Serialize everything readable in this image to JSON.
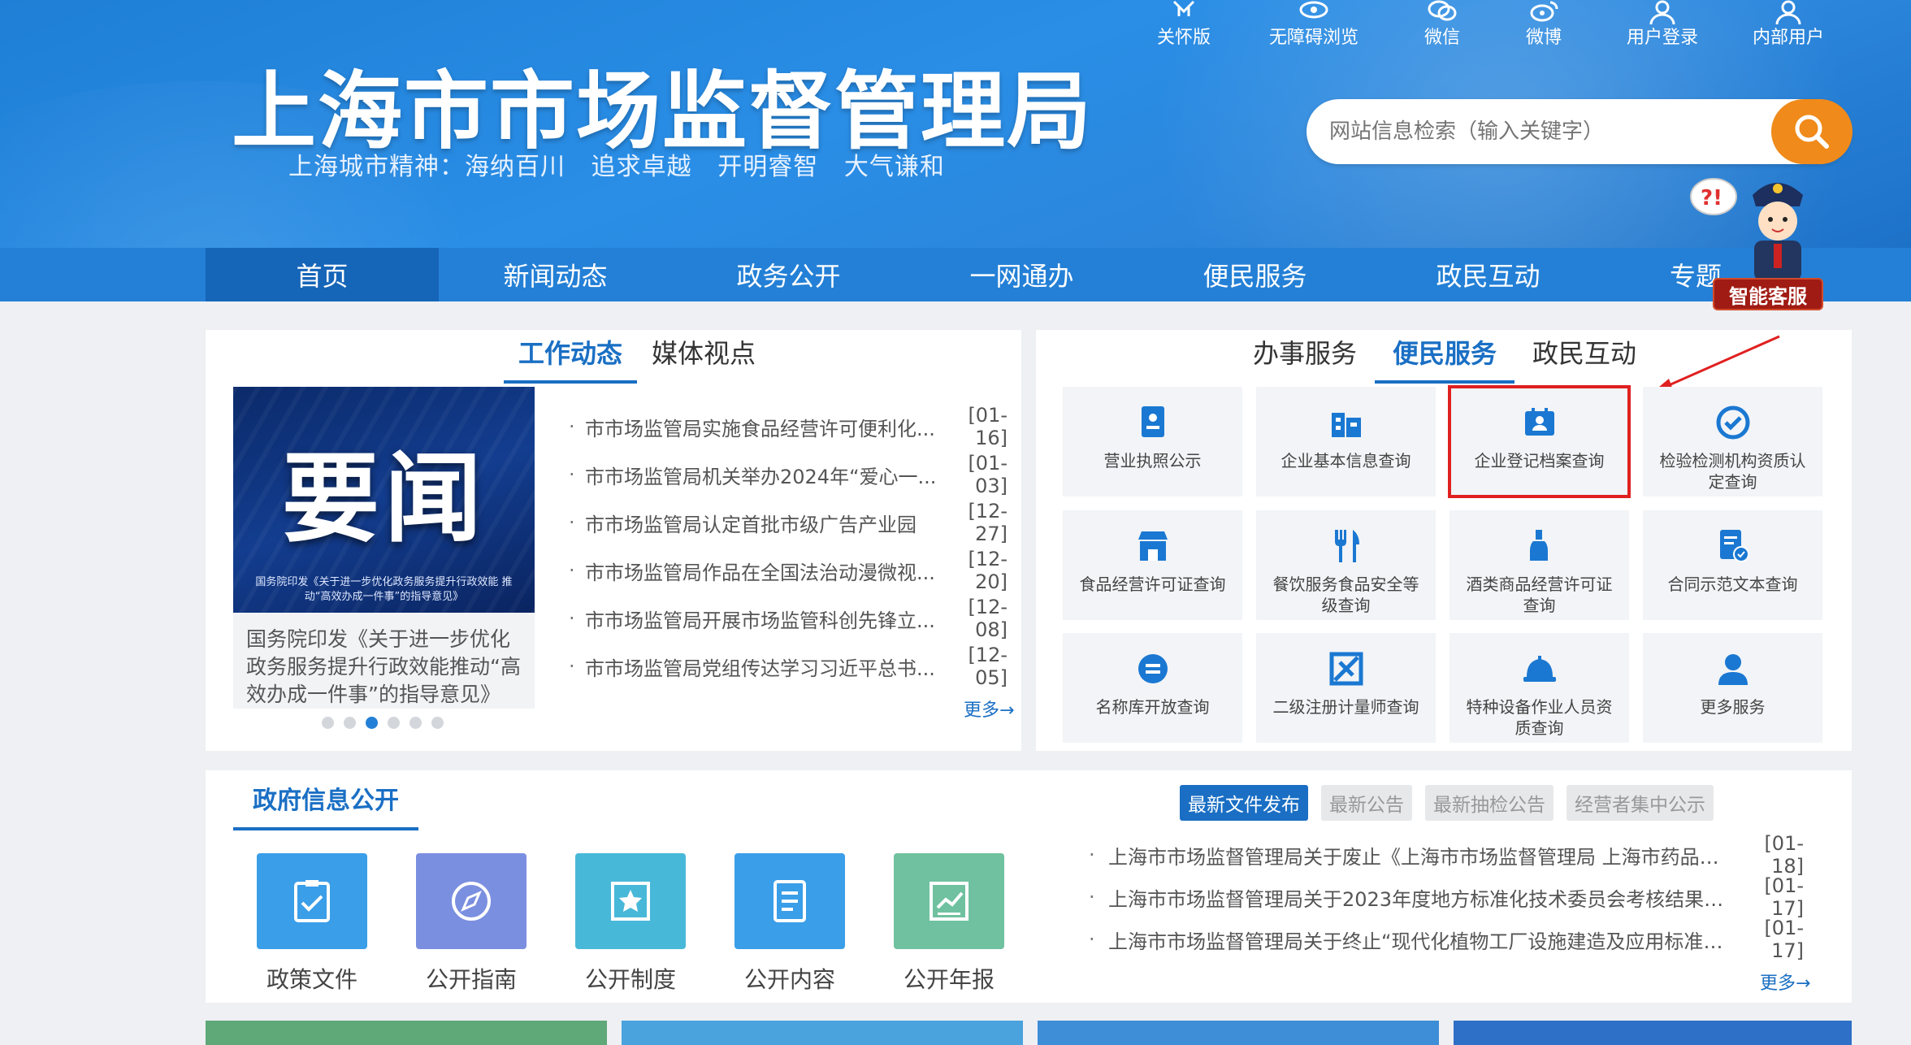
{
  "header": {
    "title": "上海市市场监督管理局",
    "slogan": "上海城市精神：海纳百川   追求卓越   开明睿智   大气谦和",
    "tools": [
      {
        "label": "关怀版",
        "icon": "care-mode-icon"
      },
      {
        "label": "无障碍浏览",
        "icon": "accessibility-eye-icon"
      },
      {
        "label": "微信",
        "icon": "wechat-icon"
      },
      {
        "label": "微博",
        "icon": "weibo-icon"
      },
      {
        "label": "用户登录",
        "icon": "user-login-icon"
      },
      {
        "label": "内部用户",
        "icon": "internal-user-icon"
      }
    ],
    "search_placeholder": "网站信息检索（输入关键字）",
    "assistant_label": "智能客服"
  },
  "nav": {
    "items": [
      "首页",
      "新闻动态",
      "政务公开",
      "一网通办",
      "便民服务",
      "政民互动",
      "专题"
    ]
  },
  "news": {
    "tabs": [
      "工作动态",
      "媒体视点"
    ],
    "feature_image_text": "要闻",
    "feature_image_subtext": "国务院印发《关于进一步优化政务服务提升行政效能 推动“高效办成一件事”的指导意见》",
    "feature_caption": "国务院印发《关于进一步优化政务服务提升行政效能推动“高效办成一件事”的指导意见》",
    "items": [
      {
        "title": "市市场监管局实施食品经营许可便利化...",
        "date": "[01-16]"
      },
      {
        "title": "市市场监管局机关举办2024年“爱心一...",
        "date": "[01-03]"
      },
      {
        "title": "市市场监管局认定首批市级广告产业园",
        "date": "[12-27]"
      },
      {
        "title": "市市场监管局作品在全国法治动漫微视...",
        "date": "[12-20]"
      },
      {
        "title": "市市场监管局开展市场监管科创先锋立...",
        "date": "[12-08]"
      },
      {
        "title": "市市场监管局党组传达学习习近平总书...",
        "date": "[12-05]"
      }
    ],
    "more": "更多→"
  },
  "services": {
    "tabs": [
      "办事服务",
      "便民服务",
      "政民互动"
    ],
    "items": [
      {
        "label": "营业执照公示",
        "icon": "business-license-icon"
      },
      {
        "label": "企业基本信息查询",
        "icon": "enterprise-building-icon"
      },
      {
        "label": "企业登记档案查询",
        "icon": "registration-archive-icon"
      },
      {
        "label": "检验检测机构资质认定查询",
        "icon": "inspection-check-icon"
      },
      {
        "label": "食品经营许可证查询",
        "icon": "food-store-icon"
      },
      {
        "label": "餐饮服务食品安全等级查询",
        "icon": "fork-knife-icon"
      },
      {
        "label": "酒类商品经营许可证查询",
        "icon": "wine-bottle-icon"
      },
      {
        "label": "合同示范文本查询",
        "icon": "contract-document-icon"
      },
      {
        "label": "名称库开放查询",
        "icon": "name-library-icon"
      },
      {
        "label": "二级注册计量师查询",
        "icon": "metrologist-icon"
      },
      {
        "label": "特种设备作业人员资质查询",
        "icon": "hard-hat-icon"
      },
      {
        "label": "更多服务",
        "icon": "more-services-user-icon"
      }
    ]
  },
  "gov_info": {
    "title": "政府信息公开",
    "items": [
      {
        "label": "政策文件",
        "icon": "policy-clipboard-icon",
        "color": "#3a9ee8"
      },
      {
        "label": "公开指南",
        "icon": "compass-icon",
        "color": "#7b8fe0"
      },
      {
        "label": "公开制度",
        "icon": "star-box-icon",
        "color": "#48b8d8"
      },
      {
        "label": "公开内容",
        "icon": "document-lines-icon",
        "color": "#3a9ee8"
      },
      {
        "label": "公开年报",
        "icon": "chart-report-icon",
        "color": "#6fc1a0"
      }
    ],
    "doc_tabs": [
      "最新文件发布",
      "最新公告",
      "最新抽检公告",
      "经营者集中公示"
    ],
    "docs": [
      {
        "title": "上海市市场监督管理局关于废止《上海市市场监督管理局 上海市药品监...",
        "date": "[01-18]"
      },
      {
        "title": "上海市市场监督管理局关于2023年度地方标准化技术委员会考核结果的...",
        "date": "[01-17]"
      },
      {
        "title": "上海市市场监督管理局关于终止“现代化植物工厂设施建造及应用标准化...",
        "date": "[01-17]"
      }
    ],
    "more": "更多→"
  },
  "colors": {
    "primary": "#1a6fc4",
    "nav_bg": "#2480d6",
    "search_btn": "#f08a1a",
    "highlight": "#e02020"
  }
}
